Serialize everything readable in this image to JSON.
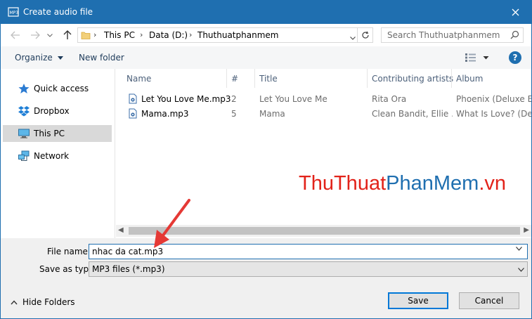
{
  "window": {
    "title": "Create audio file"
  },
  "address_bar": {
    "crumbs": [
      "This PC",
      "Data (D:)",
      "Thuthuatphanmem"
    ]
  },
  "search": {
    "placeholder": "Search Thuthuatphanmem"
  },
  "toolbar": {
    "organize_label": "Organize",
    "new_folder_label": "New folder"
  },
  "sidebar": {
    "items": [
      {
        "label": "Quick access",
        "icon": "star-icon",
        "selected": false
      },
      {
        "label": "Dropbox",
        "icon": "dropbox-icon",
        "selected": false
      },
      {
        "label": "This PC",
        "icon": "computer-icon",
        "selected": true
      },
      {
        "label": "Network",
        "icon": "network-icon",
        "selected": false
      }
    ]
  },
  "file_list": {
    "columns": [
      "Name",
      "#",
      "Title",
      "Contributing artists",
      "Album"
    ],
    "rows": [
      {
        "name": "Let You Love Me.mp3",
        "track": "2",
        "title": "Let You Love Me",
        "artists": "Rita Ora",
        "album": "Phoenix (Deluxe Edit"
      },
      {
        "name": "Mama.mp3",
        "track": "5",
        "title": "Mama",
        "artists": "Clean Bandit, Ellie ...",
        "album": "What Is Love? (Delux"
      }
    ]
  },
  "watermark": {
    "part1": "ThuThuat",
    "part2": "PhanMem",
    "part3": ".vn"
  },
  "form": {
    "file_name_label": "File name:",
    "file_name_value": "nhac da cat.mp3",
    "save_type_label": "Save as type:",
    "save_type_value": "MP3 files (*.mp3)"
  },
  "footer": {
    "hide_folders_label": "Hide Folders",
    "save_label": "Save",
    "cancel_label": "Cancel"
  },
  "colors": {
    "title_bar": "#1f6fb0",
    "watermark_red": "#e2231a",
    "watermark_blue": "#1f6fb0",
    "arrow_red": "#e53935"
  }
}
